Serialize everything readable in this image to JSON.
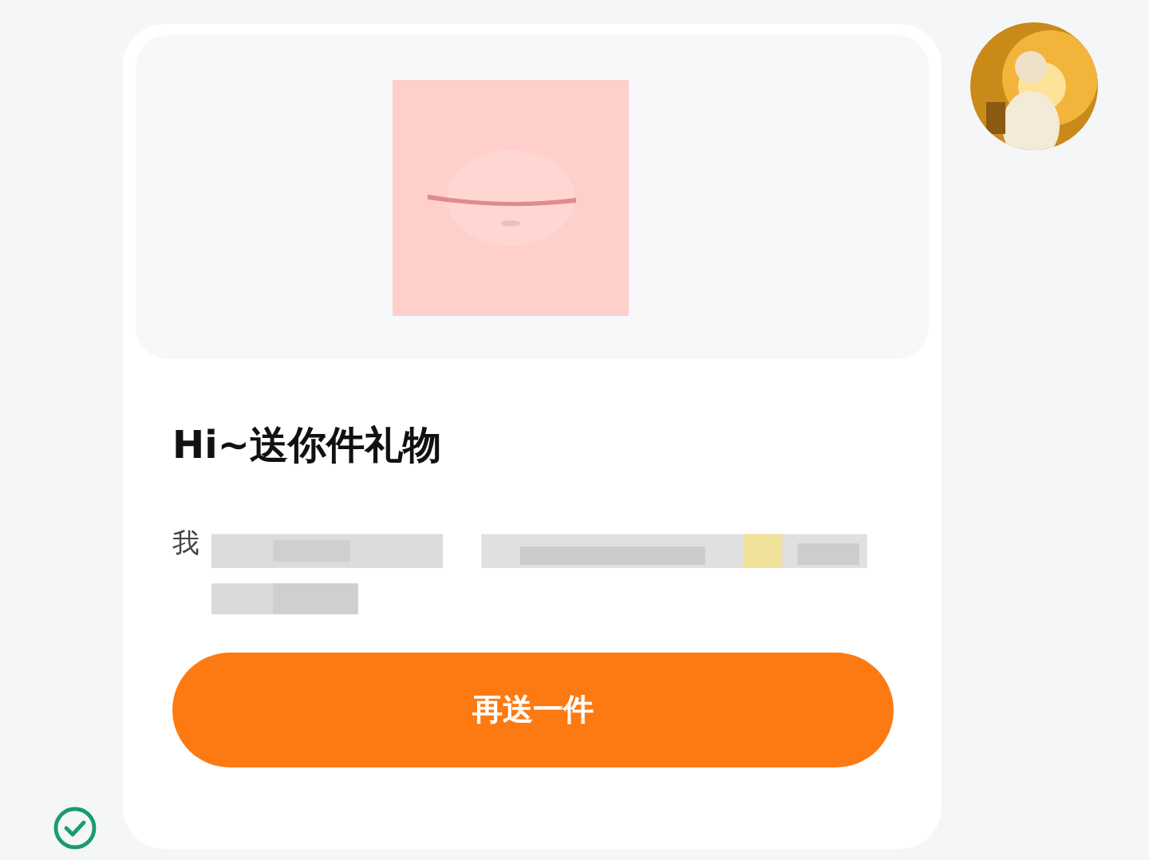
{
  "card": {
    "title": "Hi~送你件礼物",
    "message": "我",
    "button": "再送一件"
  }
}
